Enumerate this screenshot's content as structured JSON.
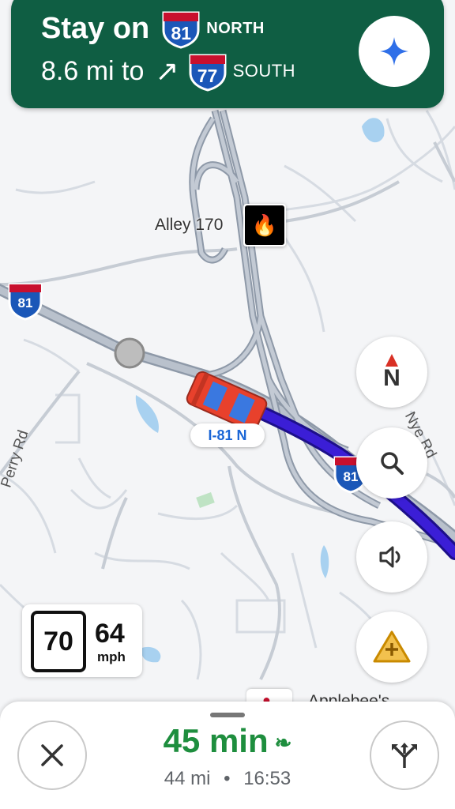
{
  "banner": {
    "line1_text": "Stay on",
    "line1_shield": "81",
    "line1_direction": "NORTH",
    "line2_distance": "8.6 mi to",
    "line2_turn_icon": "turn-right-arrow",
    "line2_shield": "77",
    "line2_direction": "SOUTH",
    "ai_icon": "sparkle-icon"
  },
  "map": {
    "place_label": "Alley 170",
    "poi_icon": "phoenix-logo",
    "shield_i81_left": "81",
    "shield_i81_right": "81",
    "current_road_chip": "I-81 N",
    "road_perry": "Perry Rd",
    "road_nye": "Nye Rd",
    "poi_bottom_label": "Applebee's"
  },
  "controls": {
    "compass_label": "N",
    "search_icon": "search-icon",
    "sound_icon": "volume-icon",
    "report_icon": "report-incident-icon"
  },
  "speed": {
    "limit": "70",
    "current": "64",
    "unit": "mph"
  },
  "trip": {
    "duration": "45 min",
    "distance": "44 mi",
    "separator": "•",
    "arrival": "16:53",
    "close_icon": "close-icon",
    "routes_icon": "alternate-routes-icon"
  },
  "colors": {
    "banner": "#0f5e43",
    "route": "#3b1ed6",
    "eta": "#1e8e3e",
    "shield": "#1b57b8"
  }
}
